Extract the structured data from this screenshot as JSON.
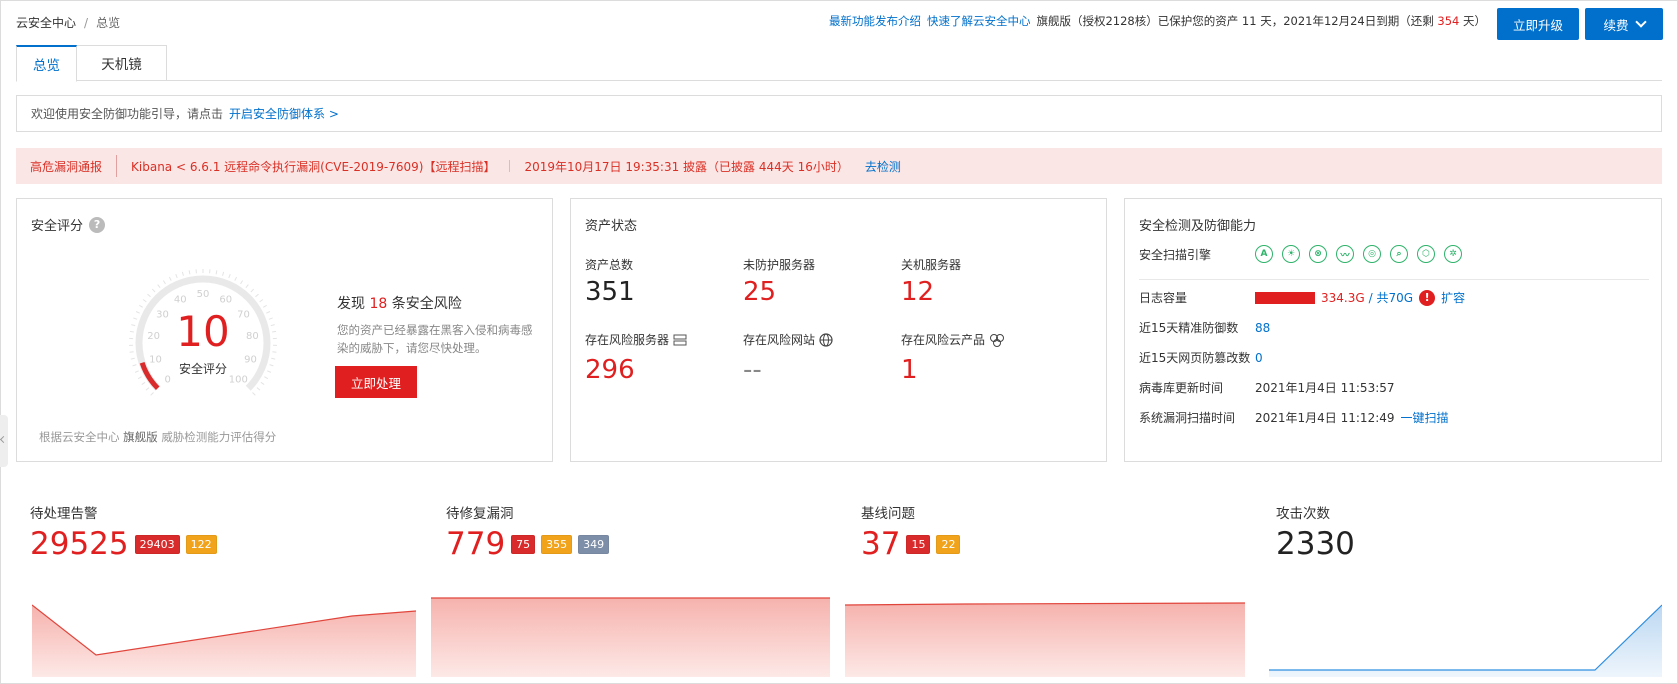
{
  "breadcrumb": {
    "root": "云安全中心",
    "sep": "/",
    "current": "总览"
  },
  "topbar": {
    "link_new": "最新功能发布介绍",
    "link_learn": "快速了解云安全中心",
    "edition_text": "旗舰版（授权2128核）已保护您的资产 11 天，2021年12月24日到期（还剩",
    "days_left": "354",
    "days_suffix": "天）",
    "upgrade_label": "立即升级",
    "renew_label": "续费"
  },
  "tabs": [
    {
      "label": "总览"
    },
    {
      "label": "天机镜"
    }
  ],
  "guide": {
    "text": "欢迎使用安全防御功能引导，请点击",
    "link": "开启安全防御体系 >"
  },
  "alert": {
    "label": "高危漏洞通报",
    "title": "Kibana < 6.6.1 远程命令执行漏洞(CVE-2019-7609)【远程扫描】",
    "disclosed": "2019年10月17日 19:35:31 披露（已披露 444天 16小时）",
    "action": "去检测"
  },
  "score_card": {
    "title": "安全评分",
    "help": "?",
    "score": "10",
    "score_label": "安全评分",
    "ticks": [
      "0",
      "10",
      "20",
      "30",
      "40",
      "50",
      "60",
      "70",
      "80",
      "90",
      "100"
    ],
    "risk_prefix": "发现",
    "risk_count": "18",
    "risk_suffix": "条安全风险",
    "risk_desc": "您的资产已经暴露在黑客入侵和病毒感染的威胁下，请您尽快处理。",
    "action": "立即处理",
    "footnote_prefix": "根据云安全中心",
    "footnote_edition": "旗舰版",
    "footnote_suffix": "威胁检测能力评估得分"
  },
  "asset_card": {
    "title": "资产状态",
    "total_label": "资产总数",
    "total": "351",
    "unprotected_label": "未防护服务器",
    "unprotected": "25",
    "shutdown_label": "关机服务器",
    "shutdown": "12",
    "risk_server_label": "存在风险服务器",
    "risk_server": "296",
    "risk_site_label": "存在风险网站",
    "risk_site": "--",
    "risk_cloud_label": "存在风险云产品",
    "risk_cloud": "1"
  },
  "capability_card": {
    "title": "安全检测及防御能力",
    "engines_label": "安全扫描引擎",
    "engines": [
      "A",
      "☀",
      "⊗",
      "〰",
      "◎",
      "⌕",
      "⬡",
      "✲"
    ],
    "log_label": "日志容量",
    "log_used": "334.3G",
    "log_total": "/ 共70G",
    "log_action": "扩容",
    "defense_label": "近15天精准防御数",
    "defense": "88",
    "tamper_label": "近15天网页防篡改数",
    "tamper": "0",
    "virus_label": "病毒库更新时间",
    "virus_time": "2021年1月4日 11:53:57",
    "vuln_label": "系统漏洞扫描时间",
    "vuln_time": "2021年1月4日 11:12:49",
    "vuln_action": "一键扫描"
  },
  "metrics": [
    {
      "label": "待处理告警",
      "value": "29525",
      "badges": [
        "29403",
        "122"
      ]
    },
    {
      "label": "待修复漏洞",
      "value": "779",
      "badges": [
        "75",
        "355",
        "349"
      ]
    },
    {
      "label": "基线问题",
      "value": "37",
      "badges": [
        "15",
        "22"
      ]
    },
    {
      "label": "攻击次数",
      "value": "2330",
      "badges": []
    }
  ],
  "colors": {
    "primary": "#0070cc",
    "danger": "#e02020",
    "orange": "#f1a31b",
    "gray_badge": "#7d8fa8",
    "engine_green": "#2fb36b",
    "alert_bg": "#fbe6e6"
  }
}
